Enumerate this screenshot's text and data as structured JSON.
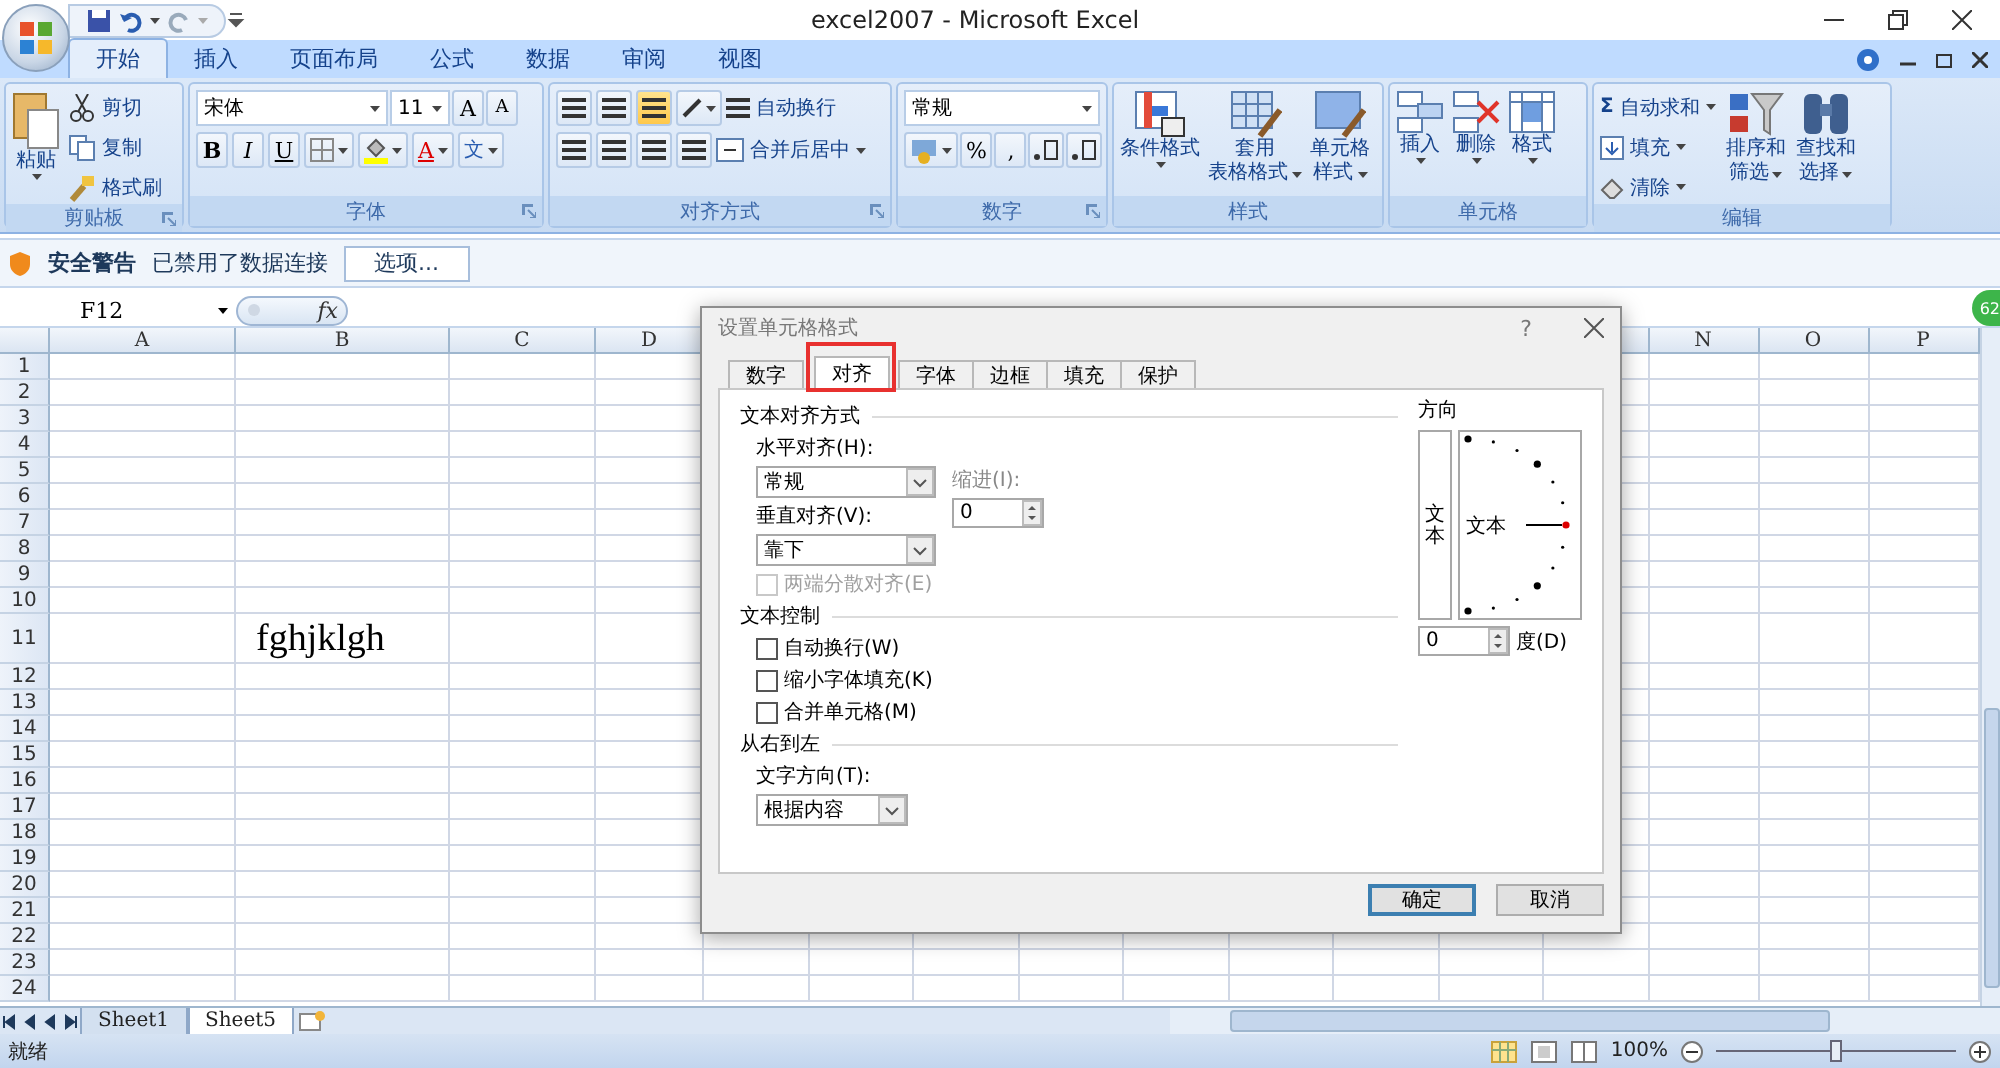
{
  "window": {
    "title": "excel2007 - Microsoft Excel"
  },
  "ribbon_tabs": [
    {
      "label": "开始",
      "selected": true
    },
    {
      "label": "插入",
      "selected": false
    },
    {
      "label": "页面布局",
      "selected": false
    },
    {
      "label": "公式",
      "selected": false
    },
    {
      "label": "数据",
      "selected": false
    },
    {
      "label": "审阅",
      "selected": false
    },
    {
      "label": "视图",
      "selected": false
    }
  ],
  "clipboard": {
    "label": "剪贴板",
    "paste": "粘贴",
    "items": [
      "剪切",
      "复制",
      "格式刷"
    ]
  },
  "font": {
    "label": "字体",
    "name": "宋体",
    "size": "11",
    "grow": "A",
    "shrink": "A",
    "bold": "B",
    "italic": "I",
    "underline": "U",
    "font_color": "A",
    "phonetic": "文"
  },
  "alignment": {
    "label": "对齐方式",
    "vertical_align": [
      {
        "selected": false
      },
      {
        "selected": false
      },
      {
        "selected": true
      }
    ],
    "wrap": "自动换行",
    "merge": "合并后居中"
  },
  "number": {
    "label": "数字",
    "format": "常规",
    "percent": "%",
    "comma": ","
  },
  "styles": {
    "label": "样式",
    "buttons": [
      {
        "lines": [
          "条件格式"
        ]
      },
      {
        "lines": [
          "套用",
          "表格格式"
        ]
      },
      {
        "lines": [
          "单元格",
          "样式"
        ]
      }
    ]
  },
  "cells": {
    "label": "单元格",
    "buttons": [
      {
        "lines": [
          "插入"
        ]
      },
      {
        "lines": [
          "删除"
        ]
      },
      {
        "lines": [
          "格式"
        ]
      }
    ]
  },
  "editing": {
    "label": "编辑",
    "sum_glyph": "Σ",
    "small": [
      "自动求和",
      "填充",
      "清除"
    ],
    "big": [
      {
        "lines": [
          "排序和",
          "筛选"
        ]
      },
      {
        "lines": [
          "查找和",
          "选择"
        ]
      }
    ]
  },
  "security_bar": {
    "title": "安全警告",
    "message": "已禁用了数据连接",
    "button": "选项..."
  },
  "formula_bar": {
    "name_box": "F12",
    "fx": "fx"
  },
  "sheet": {
    "columns": [
      {
        "label": "A"
      },
      {
        "label": "B"
      },
      {
        "label": "C"
      },
      {
        "label": "D"
      },
      {
        "label": "N"
      },
      {
        "label": "O"
      },
      {
        "label": "P"
      }
    ],
    "rows": [
      {
        "label": "1"
      },
      {
        "label": "2"
      },
      {
        "label": "3"
      },
      {
        "label": "4"
      },
      {
        "label": "5"
      },
      {
        "label": "6"
      },
      {
        "label": "7"
      },
      {
        "label": "8"
      },
      {
        "label": "9"
      },
      {
        "label": "10"
      },
      {
        "label": "11",
        "tall": true,
        "cells": [
          null,
          "fghjklgh"
        ]
      },
      {
        "label": "12"
      },
      {
        "label": "13"
      },
      {
        "label": "14"
      },
      {
        "label": "15"
      },
      {
        "label": "16"
      },
      {
        "label": "17"
      },
      {
        "label": "18"
      },
      {
        "label": "19"
      },
      {
        "label": "20"
      },
      {
        "label": "21"
      },
      {
        "label": "22"
      },
      {
        "label": "23"
      },
      {
        "label": "24"
      }
    ]
  },
  "sheet_tabs": [
    {
      "label": "Sheet1",
      "selected": false
    },
    {
      "label": "Sheet5",
      "selected": true
    }
  ],
  "badge": "62",
  "status_bar": {
    "status": "就绪",
    "zoom": "100%",
    "zoom_slider": {
      "level": 0.5
    }
  },
  "dialog": {
    "title": "设置单元格格式",
    "help": "?",
    "tabs": [
      {
        "label": "数字",
        "selected": false
      },
      {
        "label": "对齐",
        "selected": true
      },
      {
        "label": "字体",
        "selected": false
      },
      {
        "label": "边框",
        "selected": false
      },
      {
        "label": "填充",
        "selected": false
      },
      {
        "label": "保护",
        "selected": false
      }
    ],
    "alignment_section": "文本对齐方式",
    "horizontal_label": "水平对齐(H):",
    "horizontal_value": "常规",
    "indent_label": "缩进(I):",
    "indent_value": "0",
    "vertical_label": "垂直对齐(V):",
    "vertical_value": "靠下",
    "justify_distributed": {
      "label": "两端分散对齐(E)",
      "checked": false,
      "disabled": true
    },
    "control_section": "文本控制",
    "checkboxes": [
      {
        "label": "自动换行(W)",
        "checked": false
      },
      {
        "label": "缩小字体填充(K)",
        "checked": false
      },
      {
        "label": "合并单元格(M)",
        "checked": false
      }
    ],
    "rtl_section": "从右到左",
    "direction_label": "文字方向(T):",
    "direction_value": "根据内容",
    "orientation": {
      "title": "方向",
      "vertical_text": "文本",
      "text": "文本",
      "degrees_value": "0",
      "degrees_label": "度(D)"
    },
    "buttons": [
      {
        "label": "确定",
        "kind": "default"
      },
      {
        "label": "取消",
        "kind": "normal"
      }
    ]
  }
}
